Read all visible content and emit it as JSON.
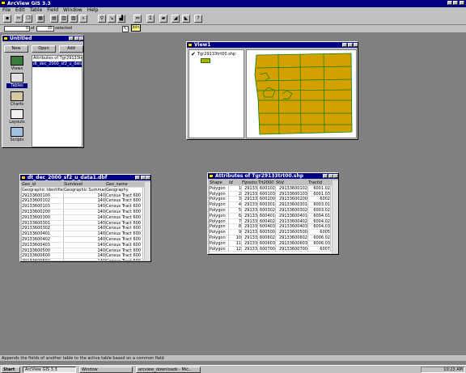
{
  "app": {
    "title": "ArcView GIS 3.3"
  },
  "menu": [
    "File",
    "Edit",
    "Table",
    "Field",
    "Window",
    "Help"
  ],
  "selection": {
    "count": "0",
    "of_label": "of",
    "total": "35",
    "selected_label": "selected"
  },
  "toolbar": {
    "join_label": "Join"
  },
  "project": {
    "title": "Untitled",
    "buttons": [
      "New",
      "Open",
      "Add"
    ],
    "docs": [
      "Views",
      "Tables",
      "Charts",
      "Layouts",
      "Scripts"
    ],
    "tables": [
      "Attributes of Tgr29133trt00.shp",
      "dt_dec_2000_sf2_u_data1"
    ]
  },
  "view": {
    "title": "View1",
    "layer": "Tgr29133trt00.shp",
    "fill_color": "#d4a000",
    "outline_color": "#008000"
  },
  "table1": {
    "title": "dt_dec_2000_sf2_u_data1.dbf",
    "headers": [
      "Geo_id",
      "Sumlevel",
      "Geo_name"
    ],
    "rows": [
      [
        "Geographic Identifier",
        "Geographic Summary L",
        "Geography"
      ],
      [
        "29133600100",
        "140",
        "Census Tract 600"
      ],
      [
        "29133600102",
        "140",
        "Census Tract 600"
      ],
      [
        "29133600103",
        "140",
        "Census Tract 600"
      ],
      [
        "29133600200",
        "140",
        "Census Tract 600"
      ],
      [
        "29133600300",
        "140",
        "Census Tract 600"
      ],
      [
        "29133600301",
        "140",
        "Census Tract 600"
      ],
      [
        "29133600302",
        "140",
        "Census Tract 600"
      ],
      [
        "29133600401",
        "140",
        "Census Tract 600"
      ],
      [
        "29133600402",
        "140",
        "Census Tract 600"
      ],
      [
        "29133600403",
        "140",
        "Census Tract 600"
      ],
      [
        "29133600500",
        "140",
        "Census Tract 600"
      ],
      [
        "29133600600",
        "140",
        "Census Tract 600"
      ],
      [
        "29133600602",
        "140",
        "Census Tract 600"
      ]
    ]
  },
  "table2": {
    "title": "Attributes of Tgr29133trt00.shp",
    "headers": [
      "Shape",
      "Id",
      "Fipsstco",
      "Trt2000",
      "Stid",
      "Tractid"
    ],
    "rows": [
      [
        "Polygon",
        "1",
        "29133",
        "600102",
        "29133600102",
        "6001.02"
      ],
      [
        "Polygon",
        "2",
        "29133",
        "600103",
        "29133600103",
        "6001.03"
      ],
      [
        "Polygon",
        "3",
        "29133",
        "600200",
        "29133600200",
        "6002"
      ],
      [
        "Polygon",
        "4",
        "29133",
        "600301",
        "29133600301",
        "6003.01"
      ],
      [
        "Polygon",
        "5",
        "29133",
        "600302",
        "29133600302",
        "6003.02"
      ],
      [
        "Polygon",
        "6",
        "29133",
        "600401",
        "29133600401",
        "6004.01"
      ],
      [
        "Polygon",
        "7",
        "29133",
        "600402",
        "29133600402",
        "6004.02"
      ],
      [
        "Polygon",
        "8",
        "29133",
        "600403",
        "29133600403",
        "6004.03"
      ],
      [
        "Polygon",
        "9",
        "29133",
        "600500",
        "29133600500",
        "6005"
      ],
      [
        "Polygon",
        "10",
        "29133",
        "600602",
        "29133600602",
        "6006.02"
      ],
      [
        "Polygon",
        "11",
        "29133",
        "600603",
        "29133600603",
        "6006.03"
      ],
      [
        "Polygon",
        "12",
        "29133",
        "600700",
        "29133600700",
        "6007"
      ]
    ]
  },
  "status": "Appends the fields of another table to the active table based on a common field",
  "taskbar": {
    "start": "Start",
    "items": [
      "ArcView GIS 3.3",
      "Window",
      "arcview_downloads - Mic..."
    ],
    "clock": "10:23 AM"
  }
}
